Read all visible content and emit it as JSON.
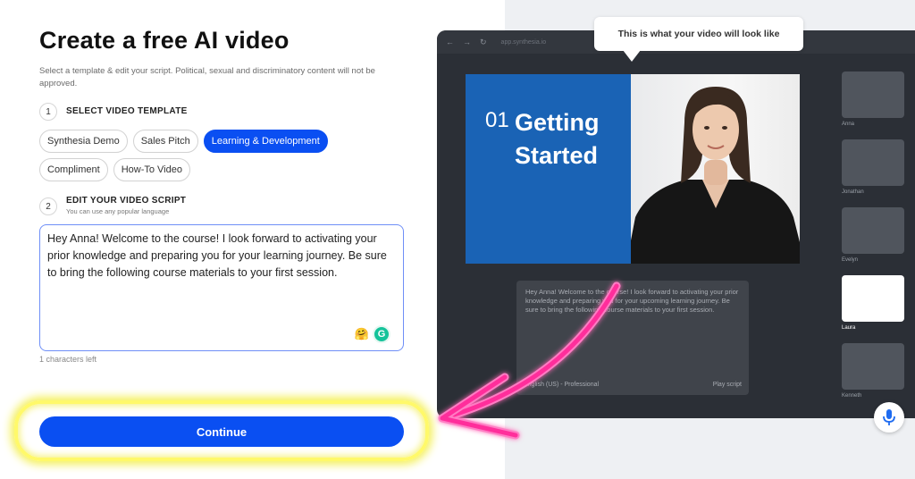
{
  "form": {
    "title": "Create a free AI video",
    "subtitle": "Select a template & edit your script. Political, sexual and discriminatory content will not be approved.",
    "step1": {
      "number": "1",
      "label": "SELECT VIDEO TEMPLATE"
    },
    "templates": [
      {
        "label": "Synthesia Demo",
        "active": false
      },
      {
        "label": "Sales Pitch",
        "active": false
      },
      {
        "label": "Learning & Development",
        "active": true
      },
      {
        "label": "Compliment",
        "active": false
      },
      {
        "label": "How-To Video",
        "active": false
      }
    ],
    "step2": {
      "number": "2",
      "label": "EDIT YOUR VIDEO SCRIPT",
      "hint": "You can use any popular language"
    },
    "script": "Hey Anna! Welcome to the course! I look forward to activating your prior knowledge and preparing you for your learning journey. Be sure to bring the following course materials to your first session.",
    "chars_left": "1 characters left",
    "continue_label": "Continue"
  },
  "preview": {
    "tooltip": "This is what your video will look like",
    "url": "app.synthesia.io",
    "slide_number": "01",
    "slide_title": "Getting Started",
    "editor_text": "Hey Anna! Welcome to the course! I look forward to activating your prior knowledge and preparing you for your upcoming learning journey. Be sure to bring the following course materials to your first session.",
    "voice": "English (US) - Professional",
    "play_label": "Play script",
    "avatars": [
      "Anna",
      "Jonathan",
      "Evelyn",
      "Laura",
      "Kenneth"
    ],
    "selected_avatar": "Laura"
  },
  "colors": {
    "accent": "#0a4ff2",
    "highlight": "#fff96a",
    "arrow": "#ff2d9b"
  }
}
